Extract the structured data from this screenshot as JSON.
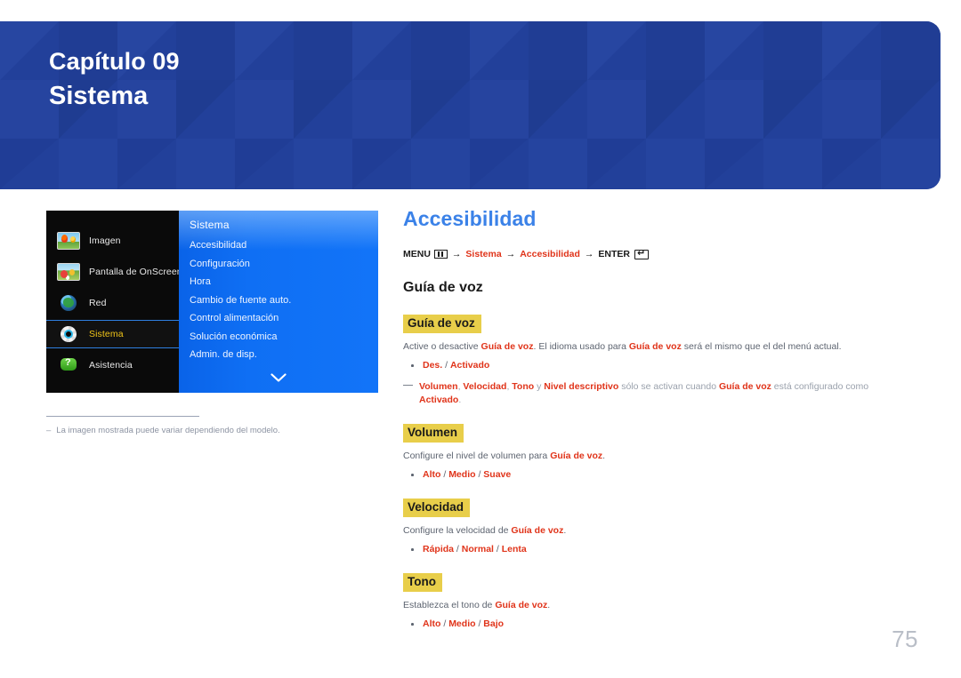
{
  "banner": {
    "chapter": "Capítulo 09",
    "title": "Sistema",
    "bg_color": "#22409a"
  },
  "osd": {
    "categories": [
      {
        "label": "Imagen",
        "icon": "picture-icon",
        "selected": false
      },
      {
        "label": "Pantalla de OnScreen",
        "icon": "onscreen-display-icon",
        "selected": false
      },
      {
        "label": "Red",
        "icon": "globe-network-icon",
        "selected": false
      },
      {
        "label": "Sistema",
        "icon": "gear-system-icon",
        "selected": true
      },
      {
        "label": "Asistencia",
        "icon": "support-question-icon",
        "selected": false
      }
    ],
    "submenu_title": "Sistema",
    "submenu_items": [
      "Accesibilidad",
      "Configuración",
      "Hora",
      "Cambio de fuente auto.",
      "Control alimentación",
      "Solución económica",
      "Admin. de disp."
    ],
    "scroll_icon": "chevron-down-icon",
    "highlight_color": "#f0c419",
    "panel_color": "#0f6ff4"
  },
  "footnote": {
    "dash": "‒",
    "text": "La imagen mostrada puede variar dependiendo del modelo."
  },
  "content": {
    "page_title": "Accesibilidad",
    "menu_path": {
      "menu_label": "MENU",
      "menu_icon": "menu-bars-icon",
      "arrow": "→",
      "step1": "Sistema",
      "step2": "Accesibilidad",
      "enter_label": "ENTER",
      "enter_icon": "enter-return-icon"
    },
    "heading": "Guía de voz",
    "sections": [
      {
        "title": "Guía de voz",
        "paragraph_parts": [
          {
            "t": "Active o desactive ",
            "style": "normal"
          },
          {
            "t": "Guía de voz",
            "style": "bold-red"
          },
          {
            "t": ". El idioma usado para ",
            "style": "normal"
          },
          {
            "t": "Guía de voz",
            "style": "bold-red"
          },
          {
            "t": " será el mismo que el del menú actual.",
            "style": "normal"
          }
        ],
        "options": [
          "Des.",
          "Activado"
        ],
        "note_parts": [
          {
            "t": "Volumen",
            "style": "bold-red"
          },
          {
            "t": ", ",
            "style": "gray"
          },
          {
            "t": "Velocidad",
            "style": "bold-red"
          },
          {
            "t": ", ",
            "style": "gray"
          },
          {
            "t": "Tono",
            "style": "bold-red"
          },
          {
            "t": " y ",
            "style": "gray"
          },
          {
            "t": "Nivel descriptivo",
            "style": "bold-red"
          },
          {
            "t": " sólo se activan cuando ",
            "style": "gray"
          },
          {
            "t": "Guía de voz",
            "style": "bold-red"
          },
          {
            "t": " está configurado como ",
            "style": "gray"
          },
          {
            "t": "Activado",
            "style": "bold-red"
          },
          {
            "t": ".",
            "style": "gray"
          }
        ]
      },
      {
        "title": "Volumen",
        "paragraph_parts": [
          {
            "t": "Configure el nivel de volumen para ",
            "style": "normal"
          },
          {
            "t": "Guía de voz",
            "style": "bold-red"
          },
          {
            "t": ".",
            "style": "normal"
          }
        ],
        "options": [
          "Alto",
          "Medio",
          "Suave"
        ],
        "note_parts": []
      },
      {
        "title": "Velocidad",
        "paragraph_parts": [
          {
            "t": "Configure la velocidad de ",
            "style": "normal"
          },
          {
            "t": "Guía de voz",
            "style": "bold-red"
          },
          {
            "t": ".",
            "style": "normal"
          }
        ],
        "options": [
          "Rápida",
          "Normal",
          "Lenta"
        ],
        "note_parts": []
      },
      {
        "title": "Tono",
        "paragraph_parts": [
          {
            "t": "Establezca el tono de ",
            "style": "normal"
          },
          {
            "t": "Guía de voz",
            "style": "bold-red"
          },
          {
            "t": ".",
            "style": "normal"
          }
        ],
        "options": [
          "Alto",
          "Medio",
          "Bajo"
        ],
        "note_parts": []
      }
    ],
    "accent_red": "#e0341a",
    "highlight_yellow": "#e8ce4a",
    "title_blue": "#3b82e8"
  },
  "page_number": "75"
}
